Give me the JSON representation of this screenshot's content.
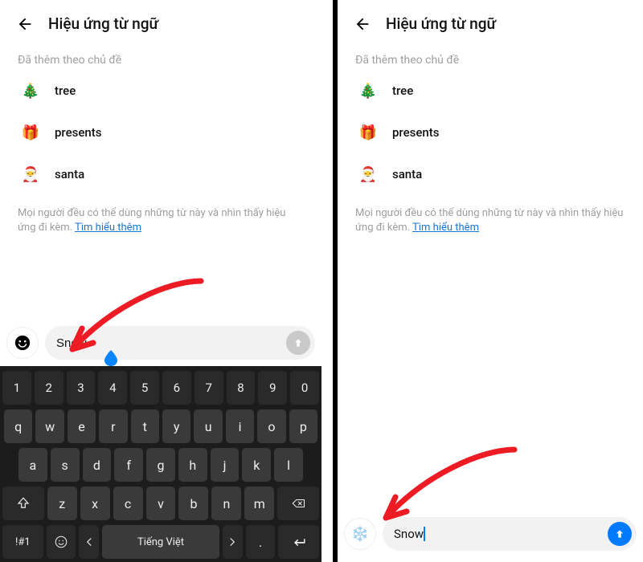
{
  "left": {
    "header": {
      "title": "Hiệu ứng từ ngữ"
    },
    "section_label": "Đã thêm theo chủ đề",
    "items": [
      {
        "emoji": "🎄",
        "label": "tree"
      },
      {
        "emoji": "🎁",
        "label": "presents"
      },
      {
        "emoji": "🎅",
        "label": "santa"
      }
    ],
    "hint_prefix": "Mọi người đều có thể dùng những từ này và nhìn thấy hiệu ứng đi kèm. ",
    "hint_link": "Tìm hiểu thêm",
    "picker_emoji": "😀",
    "input_value": "Snow",
    "keyboard": {
      "row_num": [
        "1",
        "2",
        "3",
        "4",
        "5",
        "6",
        "7",
        "8",
        "9",
        "0"
      ],
      "row_q": [
        "q",
        "w",
        "e",
        "r",
        "t",
        "y",
        "u",
        "i",
        "o",
        "p"
      ],
      "row_a": [
        "a",
        "s",
        "d",
        "f",
        "g",
        "h",
        "j",
        "k",
        "l"
      ],
      "row_z": [
        "z",
        "x",
        "c",
        "v",
        "b",
        "n",
        "m"
      ],
      "sym_label": "!#1",
      "space_label": "Tiếng Việt"
    }
  },
  "right": {
    "header": {
      "title": "Hiệu ứng từ ngữ"
    },
    "section_label": "Đã thêm theo chủ đề",
    "items": [
      {
        "emoji": "🎄",
        "label": "tree"
      },
      {
        "emoji": "🎁",
        "label": "presents"
      },
      {
        "emoji": "🎅",
        "label": "santa"
      }
    ],
    "hint_prefix": "Mọi người đều có thể dùng những từ này và nhìn thấy hiệu ứng đi kèm. ",
    "hint_link": "Tìm hiểu thêm",
    "picker_emoji": "❄️",
    "input_value": "Snow"
  },
  "colors": {
    "accent": "#007aff",
    "annotation": "#ed1c24"
  }
}
